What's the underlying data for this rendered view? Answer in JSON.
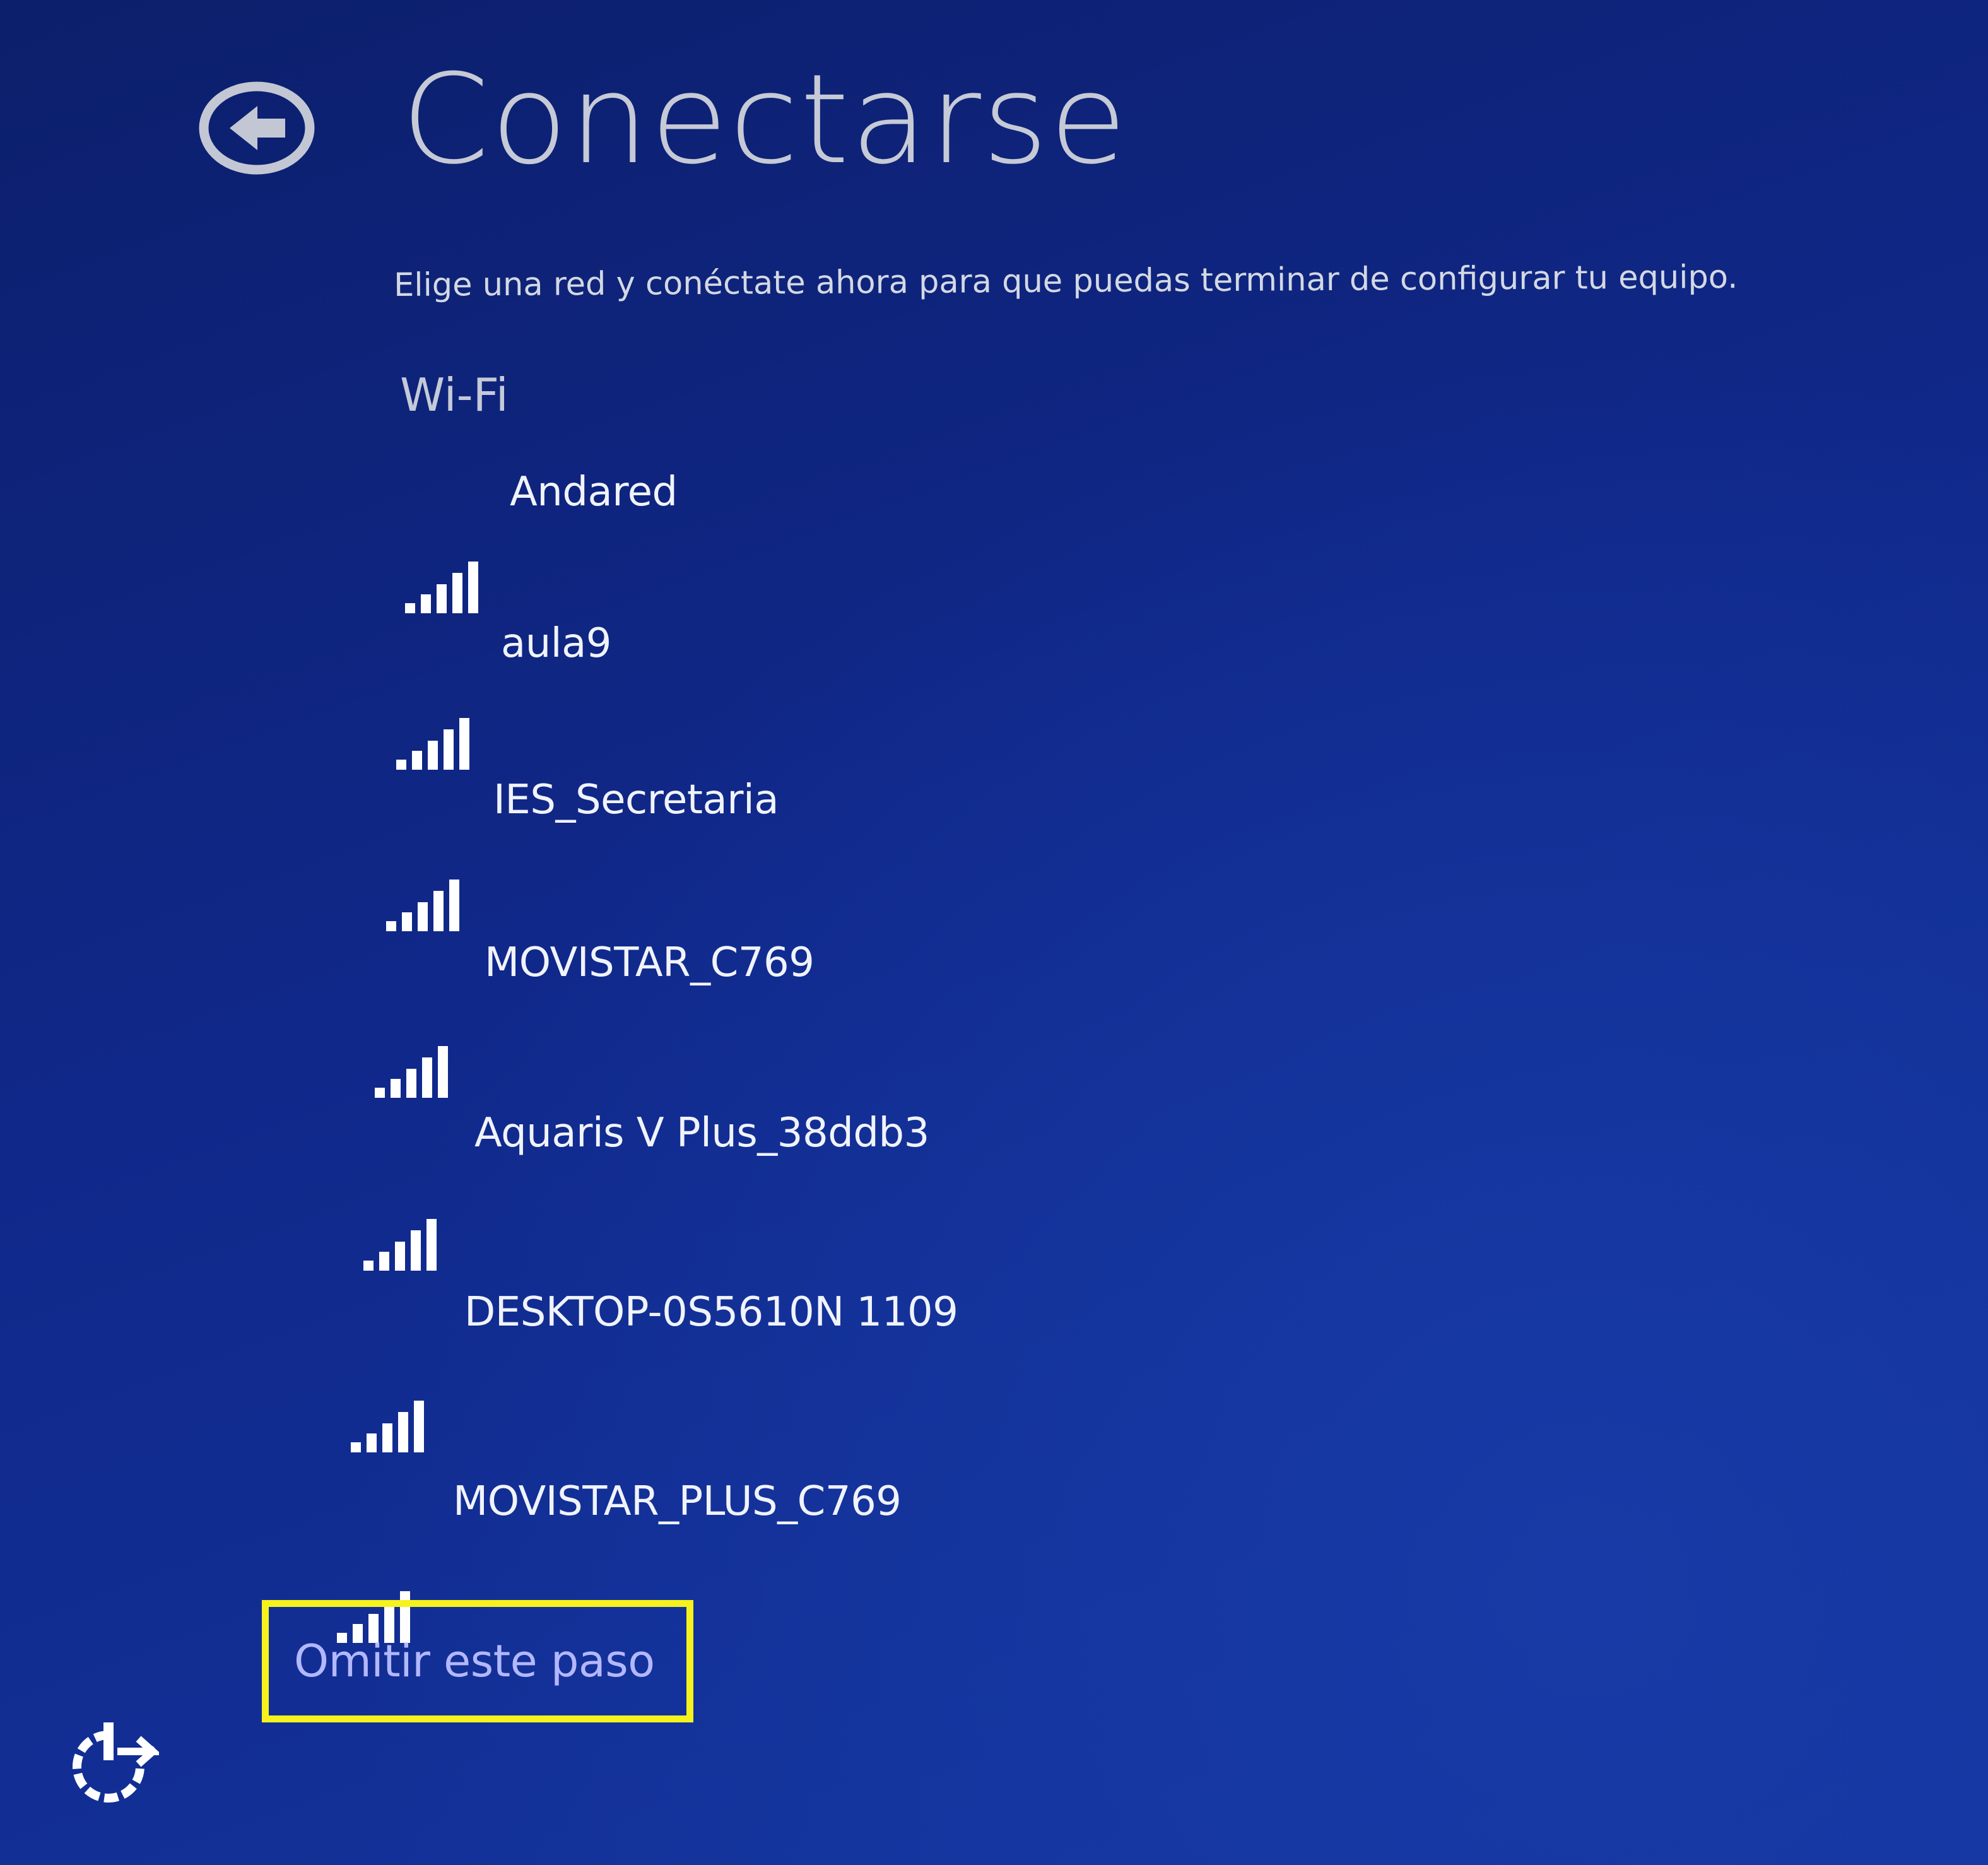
{
  "header": {
    "back_icon": "back-arrow-circle-icon",
    "title": "Conectarse"
  },
  "subtitle": "Elige una red y conéctate ahora para que puedas terminar de configurar tu equipo.",
  "wifi": {
    "section_label": "Wi-Fi",
    "signal_icon": "wifi-signal-bars-icon",
    "networks": [
      {
        "name": "Andared",
        "signal_bars": 5
      },
      {
        "name": "aula9",
        "signal_bars": 5
      },
      {
        "name": "IES_Secretaria",
        "signal_bars": 5
      },
      {
        "name": "MOVISTAR_C769",
        "signal_bars": 5
      },
      {
        "name": "Aquaris V Plus_38ddb3",
        "signal_bars": 5
      },
      {
        "name": "DESKTOP-0S5610N 1109",
        "signal_bars": 5
      },
      {
        "name": "MOVISTAR_PLUS_C769",
        "signal_bars": 5
      }
    ]
  },
  "skip": {
    "label": "Omitir este paso",
    "highlight_color": "#f6f21d"
  },
  "footer": {
    "ease_of_access_icon": "ease-of-access-icon"
  },
  "colors": {
    "background": "#10288a",
    "title_text": "#c6cad6",
    "link_text": "#b3b7ff"
  }
}
